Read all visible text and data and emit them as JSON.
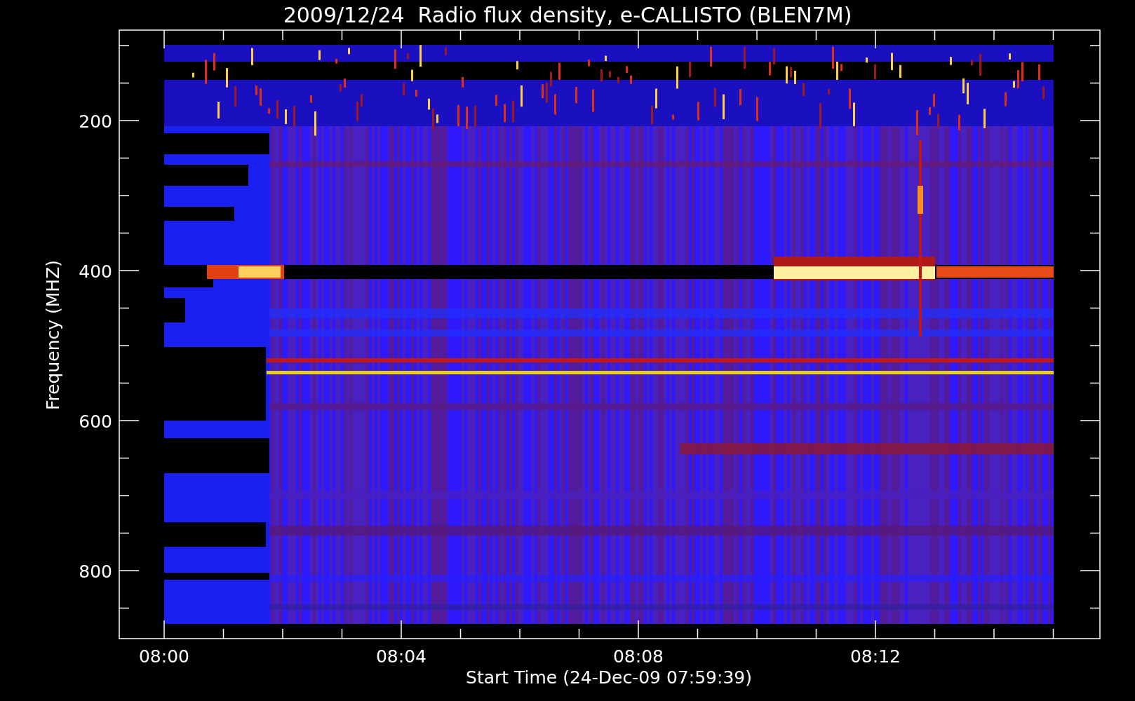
{
  "title": "2009/12/24  Radio flux density, e-CALLISTO (BLEN7M)",
  "plot": {
    "ylabel": "Frequency (MHZ)",
    "xlabel": "Start Time (24-Dec-09 07:59:39)",
    "yticks": [
      "200",
      "400",
      "600",
      "800"
    ],
    "xticks": [
      "08:00",
      "08:04",
      "08:08",
      "08:12"
    ]
  }
}
